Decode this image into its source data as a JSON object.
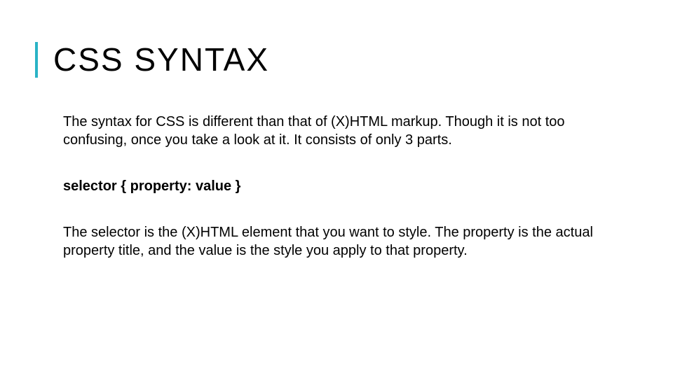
{
  "slide": {
    "title": "CSS SYNTAX",
    "paragraph1": "The syntax for CSS is different than that of (X)HTML markup. Though it is not too confusing, once you take a look at it. It consists of only 3 parts.",
    "syntax_example": "selector { property: value }",
    "paragraph2": "The selector is the (X)HTML element that you want to style. The property is the actual property title, and the value is the style you apply to that property."
  }
}
